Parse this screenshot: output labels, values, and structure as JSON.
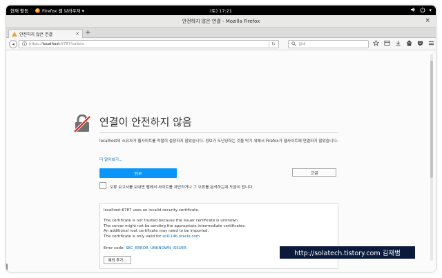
{
  "topbar": {
    "activities": "현재 활동",
    "app_name": "Firefox 웹 브라우저 ▾",
    "clock": "(토) 17:21",
    "volume_icon": "volume-icon",
    "power_icon": "power-icon",
    "menu_arrow": "▾"
  },
  "window": {
    "title": "안전하지 않은 연결 - Mozilla Firefox",
    "close_glyph": "×"
  },
  "tabs": [
    {
      "label": "안전하지 않은 연결",
      "close_glyph": "×"
    }
  ],
  "new_tab_glyph": "+",
  "navbar": {
    "back_glyph": "◂",
    "url_scheme": "https://",
    "url_host": "localhost",
    "url_rest": ":6787/solaris",
    "reload_glyph": "↻",
    "search_placeholder": "검색",
    "tool_icons": [
      "star-icon",
      "library-icon",
      "download-icon",
      "home-icon",
      "pocket-icon",
      "menu-icon"
    ]
  },
  "error_page": {
    "title": "연결이 안전하지 않음",
    "description": "localhost의 소유자가 웹사이트를 적절히 설정하지 않았습니다. 정보가 도난당하는 것을 막기 위해서 Firefox가 웹사이트에 연결하지 않았습니다.",
    "learn_more": "더 알아보기...",
    "back_button": "뒤로",
    "advanced_button": "고급",
    "report_checkbox_label": "오류 보고서를 보내면 웹에서 사이트를 차단하거나 그 오류를 분석하는데 도움이 됩니다.",
    "advanced": {
      "line1": "localhost:6787 uses an invalid security certificate.",
      "line2": "The certificate is not trusted because the issuer certificate is unknown.",
      "line3": "The server might not be sending the appropriate intermediate certificates.",
      "line4": "An additional root certificate may need to be imported.",
      "line5_prefix": "The certificate is only valid for ",
      "line5_link": "sol114b.oracle.com",
      "error_code_prefix": "Error code: ",
      "error_code": "SEC_ERROR_UNKNOWN_ISSUER",
      "exception_button": "예외 추가..."
    }
  },
  "watermark": "http://solatech.tistory.com 김재범",
  "colors": {
    "accent_blue": "#0996f8",
    "link_blue": "#0a6ab6",
    "warning": "#e8a33a",
    "lock_red": "#d92215"
  }
}
